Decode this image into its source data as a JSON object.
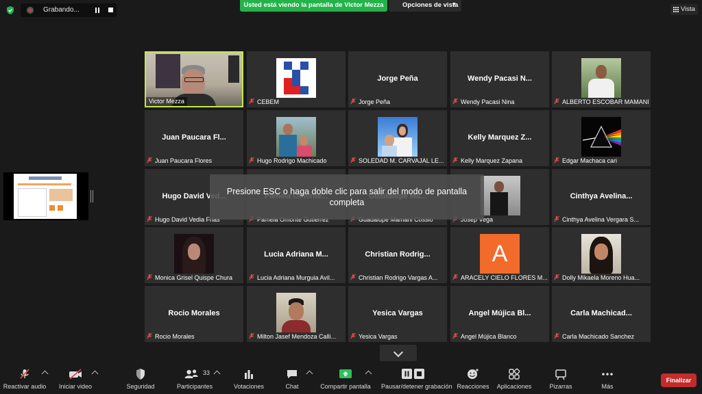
{
  "top": {
    "recording_label": "Grabando...",
    "share_banner": "Usted está viendo la pantalla de Victor Mezza",
    "view_options": "Opciones de vista",
    "view_button": "Vista"
  },
  "overlay": {
    "esc_message": "Presione ESC o haga doble clic para salir del modo de pantalla completa"
  },
  "tiles": [
    {
      "caption": "Victor Mezza",
      "big_name": "",
      "muted": false,
      "picture": "video-victor"
    },
    {
      "caption": "CEBEM",
      "big_name": "",
      "muted": true,
      "picture": "cebem-logo"
    },
    {
      "caption": "Jorge Peña",
      "big_name": "Jorge Peña",
      "muted": true,
      "picture": ""
    },
    {
      "caption": "Wendy Pacasi Nina",
      "big_name": "Wendy Pacasi N...",
      "muted": true,
      "picture": ""
    },
    {
      "caption": "ALBERTO ESCOBAR MAMANI",
      "big_name": "",
      "muted": true,
      "picture": "photo-alberto"
    },
    {
      "caption": "Juan Paucara Flores",
      "big_name": "Juan Paucara Fl...",
      "muted": true,
      "picture": ""
    },
    {
      "caption": "Hugo Rodrigo Machicado",
      "big_name": "",
      "muted": true,
      "picture": "photo-hugo"
    },
    {
      "caption": "SOLEDAD M. CARVAJAL LE...",
      "big_name": "",
      "muted": true,
      "picture": "photo-soledad"
    },
    {
      "caption": "Kelly Marquez Zapana",
      "big_name": "Kelly Marquez Z...",
      "muted": true,
      "picture": ""
    },
    {
      "caption": "Edgar Machaca cari",
      "big_name": "",
      "muted": true,
      "picture": "prism-art"
    },
    {
      "caption": "Hugo David Vedia Frias",
      "big_name": "Hugo David Ved...",
      "muted": true,
      "picture": ""
    },
    {
      "caption": "Pamela Omonte Gutierrez",
      "big_name": "Pamela Omonte...",
      "muted": true,
      "picture": ""
    },
    {
      "caption": "Guadalupe Mamani Cossio",
      "big_name": "Guadalupe Ma...",
      "muted": true,
      "picture": ""
    },
    {
      "caption": "Josep Vega",
      "big_name": "",
      "muted": true,
      "picture": "photo-josep"
    },
    {
      "caption": "Cinthya Avelina Vergara S...",
      "big_name": "Cinthya Avelina...",
      "muted": true,
      "picture": ""
    },
    {
      "caption": "Monica Grisel Quispe Chura",
      "big_name": "",
      "muted": true,
      "picture": "photo-monica"
    },
    {
      "caption": "Lucia Adriana Murguia Avil...",
      "big_name": "Lucia Adriana M...",
      "muted": true,
      "picture": ""
    },
    {
      "caption": "Christian Rodrigo Vargas A...",
      "big_name": "Christian Rodrig...",
      "muted": true,
      "picture": ""
    },
    {
      "caption": "ARACELY CIELO FLORES M...",
      "big_name": "",
      "muted": true,
      "picture": "avatar-letter-a",
      "avatar_letter": "A"
    },
    {
      "caption": "Dolly Mikaela Moreno Hua...",
      "big_name": "",
      "muted": true,
      "picture": "photo-dolly"
    },
    {
      "caption": "Rocio Morales",
      "big_name": "Rocio Morales",
      "muted": true,
      "picture": ""
    },
    {
      "caption": "Milton Jasef Mendoza Calli...",
      "big_name": "",
      "muted": true,
      "picture": "photo-milton"
    },
    {
      "caption": "Yesica Vargas",
      "big_name": "Yesica Vargas",
      "muted": true,
      "picture": ""
    },
    {
      "caption": "Angel Mújica Blanco",
      "big_name": "Angel Mújica Bl...",
      "muted": true,
      "picture": ""
    },
    {
      "caption": "Carla Machicado Sanchez",
      "big_name": "Carla Machicad...",
      "muted": true,
      "picture": ""
    }
  ],
  "toolbar": {
    "unmute": "Reactivar audio",
    "start_video": "Iniciar video",
    "security": "Seguridad",
    "participants": "Participantes",
    "participants_count": "33",
    "polls": "Votaciones",
    "chat": "Chat",
    "share_screen": "Compartir pantalla",
    "record": "Pausar/detener grabación",
    "reactions": "Reacciones",
    "apps": "Aplicaciones",
    "whiteboards": "Pizarras",
    "more": "Más",
    "end": "Finalizar"
  },
  "colors": {
    "background": "#1a1a1a",
    "tile": "#2e2e2e",
    "active_speaker_border": "#c5e74a",
    "share_banner": "#23b34a",
    "mute_red": "#e0484f",
    "end_button": "#c42b2b",
    "share_icon": "#2ec05a"
  },
  "icons": {
    "security": "shield-icon",
    "recording": "record-dot-icon",
    "mic_muted": "mic-muted-icon",
    "video_off": "video-off-icon",
    "participants": "people-icon",
    "polls": "bar-chart-icon",
    "chat": "chat-bubble-icon",
    "share": "share-arrow-icon",
    "record": "pause-stop-icon",
    "reactions": "smiley-icon",
    "apps": "apps-icon",
    "whiteboards": "whiteboard-icon",
    "more": "ellipsis-icon",
    "view": "grid-icon"
  }
}
